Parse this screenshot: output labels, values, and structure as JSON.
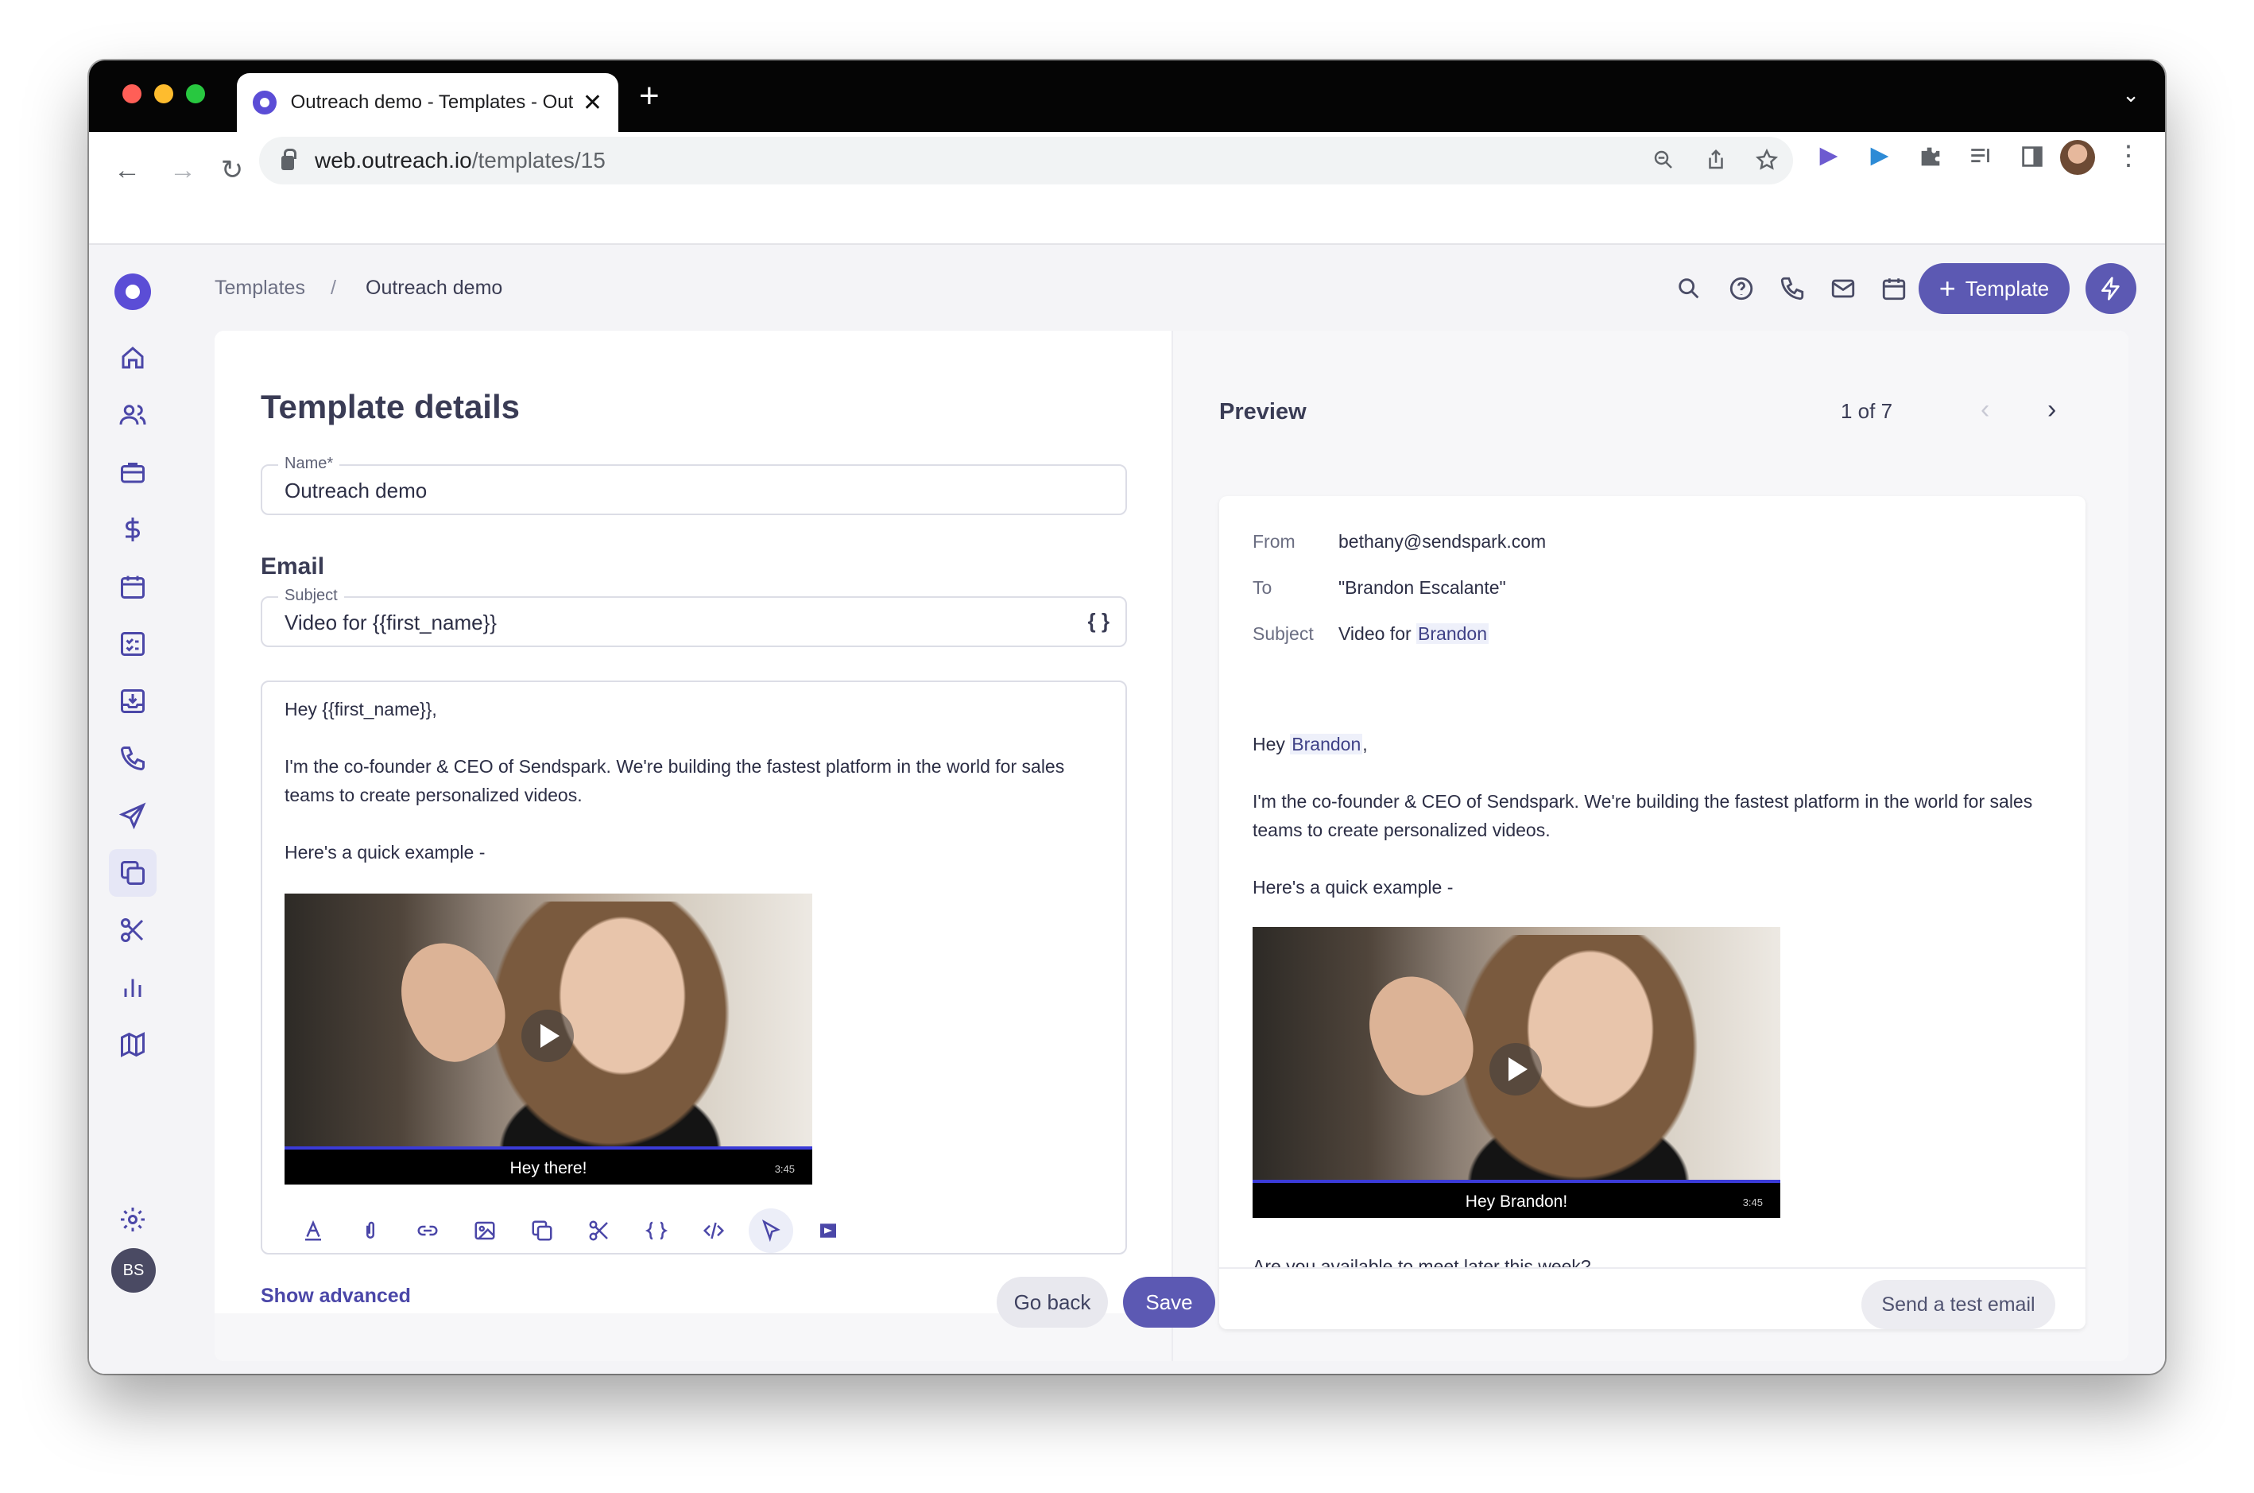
{
  "browser": {
    "tab_title": "Outreach demo - Templates - Outreach",
    "url_host": "web.outreach.io",
    "url_path": "/templates/15"
  },
  "sidebar": {
    "icons": [
      "home-icon",
      "people-icon",
      "briefcase-icon",
      "dollar-icon",
      "calendar-icon",
      "tasks-icon",
      "inbox-icon",
      "phone-icon",
      "send-icon",
      "templates-icon",
      "snippets-icon",
      "reports-icon",
      "map-icon",
      "settings-icon"
    ],
    "user_initials": "BS"
  },
  "breadcrumb": {
    "root": "Templates",
    "separator": "/",
    "current": "Outreach demo"
  },
  "header": {
    "new_template_label": "Template"
  },
  "form": {
    "title": "Template details",
    "name_label": "Name*",
    "name_value": "Outreach demo",
    "email_heading": "Email",
    "subject_label": "Subject",
    "subject_value": "Video for {{first_name}}",
    "variable_icon_glyph": "{ }",
    "body": {
      "greeting": "Hey {{first_name}},",
      "paragraph": "I'm the co-founder & CEO of Sendspark. We're building the fastest platform in the world for sales teams to create personalized videos.",
      "example": "Here's a quick example -",
      "video_caption": "Hey there!",
      "video_duration": "3:45"
    },
    "show_advanced": "Show advanced",
    "go_back": "Go back",
    "save": "Save"
  },
  "preview": {
    "title": "Preview",
    "page": "1 of 7",
    "from_label": "From",
    "from_value": "bethany@sendspark.com",
    "to_label": "To",
    "to_value": "\"Brandon Escalante\"",
    "subject_label": "Subject",
    "subject_prefix": "Video for",
    "subject_name": "Brandon",
    "greeting_prefix": "Hey",
    "greeting_name": "Brandon",
    "greeting_suffix": ",",
    "paragraph": "I'm the co-founder & CEO of Sendspark. We're building the fastest platform in the world for sales teams to create personalized videos.",
    "example": "Here's a quick example -",
    "video_caption": "Hey Brandon!",
    "video_duration": "3:45",
    "cut_text": "Are you available to meet later this week?",
    "send_test": "Send a test email"
  },
  "colors": {
    "brand": "#5c59b3",
    "sidebar_icon": "#4b47a8",
    "highlight": "#eef0fa"
  }
}
